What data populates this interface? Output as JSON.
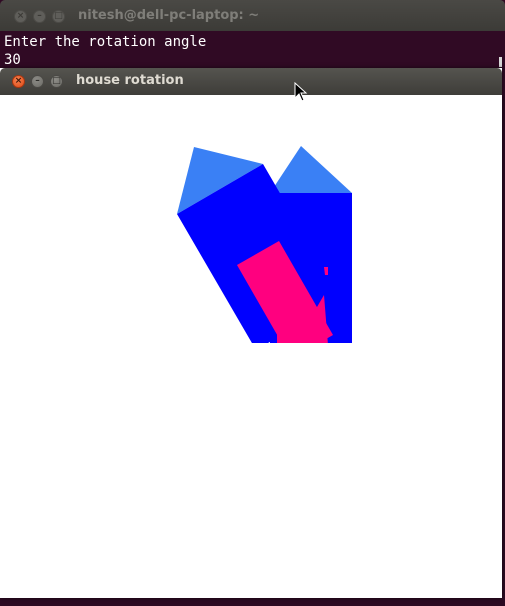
{
  "terminal": {
    "title": "nitesh@dell-pc-laptop: ~",
    "lines": [
      "Enter the rotation angle",
      "30"
    ]
  },
  "house_window": {
    "title": "house rotation"
  },
  "drawing": {
    "rotation_angle": "30",
    "colors": {
      "roof": "#3a80f5",
      "walls": "#0000ff",
      "door": "#ff007f"
    }
  }
}
